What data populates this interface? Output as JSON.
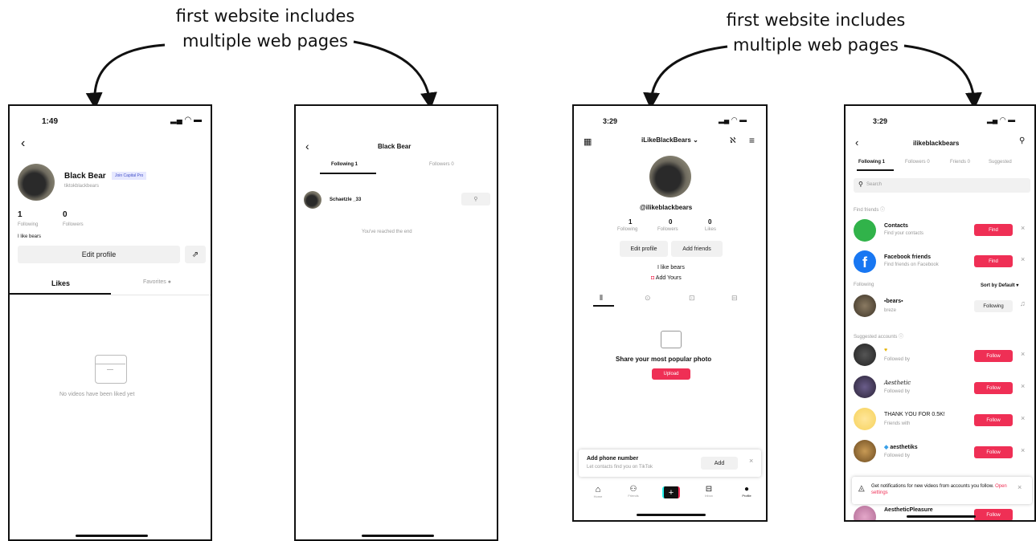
{
  "captions": {
    "left": [
      "first website includes",
      "multiple web pages"
    ],
    "right": [
      "first website includes",
      "multiple web pages"
    ]
  },
  "phone1": {
    "time": "1:49",
    "name": "Black Bear",
    "badge": "Join Capital Pro",
    "handle": "tiktokblackbears",
    "following_count": "1",
    "following_label": "Following",
    "followers_count": "0",
    "followers_label": "Followers",
    "bio": "I like bears",
    "edit_profile": "Edit profile",
    "tab_likes": "Likes",
    "tab_favorites": "Favorites",
    "empty_text": "No videos have been liked yet"
  },
  "phone2": {
    "title": "Black Bear",
    "tab_following": "Following 1",
    "tab_followers": "Followers 0",
    "user": "Schaetzle _33",
    "end_text": "You've reached the end"
  },
  "phone3": {
    "time": "3:29",
    "username": "iLikeBlackBears",
    "handle": "@ilikeblackbears",
    "stats": [
      {
        "num": "1",
        "label": "Following"
      },
      {
        "num": "0",
        "label": "Followers"
      },
      {
        "num": "0",
        "label": "Likes"
      }
    ],
    "edit_profile": "Edit profile",
    "add_friends": "Add friends",
    "bio": "I like bears",
    "add_yours": "Add Yours",
    "share_title": "Share your most popular photo",
    "upload": "Upload",
    "phone_title": "Add phone number",
    "phone_sub": "Let contacts find you on TikTok",
    "add": "Add",
    "nav": [
      "Home",
      "Friends",
      "",
      "Inbox",
      "Profile"
    ]
  },
  "phone4": {
    "time": "3:29",
    "title": "ilikeblackbears",
    "tabs": [
      "Following 1",
      "Followers 0",
      "Friends 0",
      "Suggested"
    ],
    "search_placeholder": "Search",
    "find_friends_label": "Find friends",
    "contacts_title": "Contacts",
    "contacts_sub": "Find your contacts",
    "fb_title": "Facebook friends",
    "fb_sub": "Find friends on Facebook",
    "find": "Find",
    "following_label": "Following",
    "sort_label": "Sort by Default",
    "following_user": "bears",
    "following_user_sub": "breze",
    "following_btn": "Following",
    "suggested_label": "Suggested accounts",
    "suggested": [
      {
        "name": "",
        "sub": "Followed by"
      },
      {
        "name": "Aesthetic",
        "sub": "Followed by"
      },
      {
        "name": "THANK YOU FOR 0.5K!",
        "sub": "Friends with"
      },
      {
        "name": "aesthetiks",
        "sub": "Followed by"
      }
    ],
    "follow": "Follow",
    "notif_text": "Get notifications for new videos from accounts you follow.",
    "notif_link": "Open settings",
    "last_name": "AestheticPleasure",
    "colors": {
      "accent": "#ef2f55"
    }
  }
}
